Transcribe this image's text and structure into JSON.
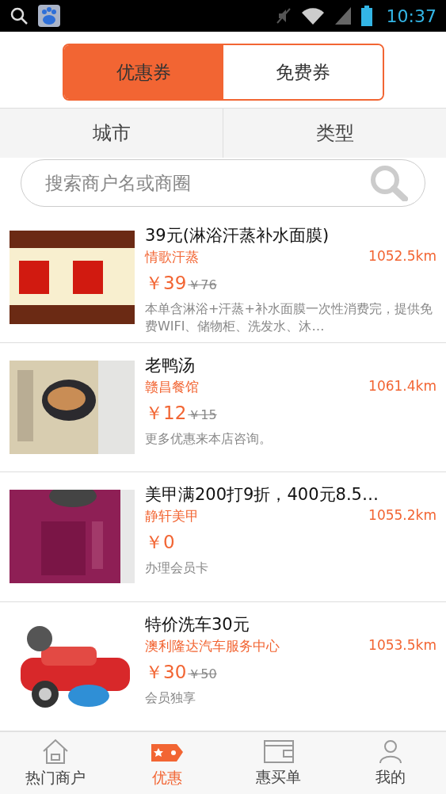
{
  "status_bar": {
    "time": "10:37"
  },
  "coupon_tabs": [
    {
      "label": "优惠券",
      "selected": true
    },
    {
      "label": "免费券",
      "selected": false
    }
  ],
  "filters": [
    {
      "label": "城市"
    },
    {
      "label": "类型"
    }
  ],
  "search": {
    "placeholder": "搜索商户名或商圈"
  },
  "deals": [
    {
      "title": "39元(淋浴汗蒸补水面膜)",
      "merchant": "情歌汗蒸",
      "distance": "1052.5km",
      "price": "￥39",
      "original_price": "￥76",
      "description": "本单含淋浴+汗蒸+补水面膜一次性消费完，提供免费WIFI、储物柜、洗发水、沐…"
    },
    {
      "title": "老鸭汤",
      "merchant": "赣昌餐馆",
      "distance": "1061.4km",
      "price": "￥12",
      "original_price": "￥15",
      "description": "更多优惠来本店咨询。"
    },
    {
      "title": "美甲满200打9折，400元8.5…",
      "merchant": "静轩美甲",
      "distance": "1055.2km",
      "price": "￥0",
      "description": "办理会员卡"
    },
    {
      "title": "特价洗车30元",
      "merchant": "澳利隆达汽车服务中心",
      "distance": "1053.5km",
      "price": "￥30",
      "original_price": "￥50",
      "description": "会员独享"
    }
  ],
  "nav": [
    {
      "label": "热门商户",
      "selected": false
    },
    {
      "label": "优惠",
      "selected": true
    },
    {
      "label": "惠买单",
      "selected": false
    },
    {
      "label": "我的",
      "selected": false
    }
  ]
}
